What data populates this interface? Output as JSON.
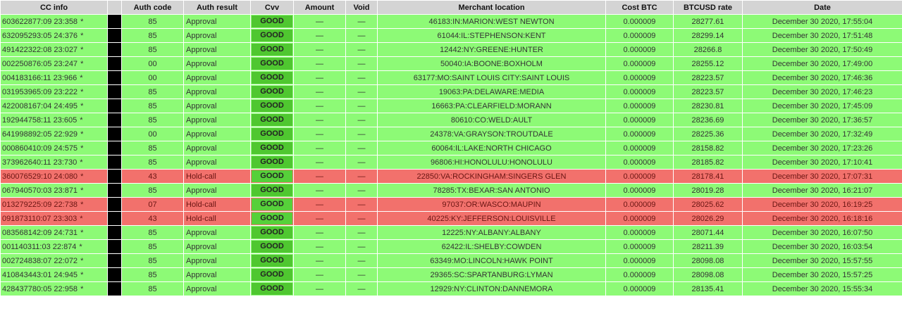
{
  "headers": [
    "CC info",
    "",
    "Auth code",
    "Auth result",
    "Cvv",
    "Amount",
    "Void",
    "Merchant location",
    "Cost BTC",
    "BTCUSD rate",
    "Date"
  ],
  "rows": [
    {
      "cc": "603622877:09 23:358",
      "star": "*",
      "code": "85",
      "result": "Approval",
      "cvv": "GOOD",
      "amount": "—",
      "void": "—",
      "loc": "46183:IN:MARION:WEST NEWTON",
      "cost": "0.000009",
      "rate": "28277.61",
      "date": "December 30 2020, 17:55:04",
      "status": "approve"
    },
    {
      "cc": "632095293:05 24:376",
      "star": "*",
      "code": "85",
      "result": "Approval",
      "cvv": "GOOD",
      "amount": "—",
      "void": "—",
      "loc": "61044:IL:STEPHENSON:KENT",
      "cost": "0.000009",
      "rate": "28299.14",
      "date": "December 30 2020, 17:51:48",
      "status": "approve"
    },
    {
      "cc": "491422322:08 23:027",
      "star": "*",
      "code": "85",
      "result": "Approval",
      "cvv": "GOOD",
      "amount": "—",
      "void": "—",
      "loc": "12442:NY:GREENE:HUNTER",
      "cost": "0.000009",
      "rate": "28266.8",
      "date": "December 30 2020, 17:50:49",
      "status": "approve"
    },
    {
      "cc": "002250876:05 23:247",
      "star": "*",
      "code": "00",
      "result": "Approval",
      "cvv": "GOOD",
      "amount": "—",
      "void": "—",
      "loc": "50040:IA:BOONE:BOXHOLM",
      "cost": "0.000009",
      "rate": "28255.12",
      "date": "December 30 2020, 17:49:00",
      "status": "approve"
    },
    {
      "cc": "004183166:11 23:966",
      "star": "*",
      "code": "00",
      "result": "Approval",
      "cvv": "GOOD",
      "amount": "—",
      "void": "—",
      "loc": "63177:MO:SAINT LOUIS CITY:SAINT LOUIS",
      "cost": "0.000009",
      "rate": "28223.57",
      "date": "December 30 2020, 17:46:36",
      "status": "approve"
    },
    {
      "cc": "031953965:09 23:222",
      "star": "*",
      "code": "85",
      "result": "Approval",
      "cvv": "GOOD",
      "amount": "—",
      "void": "—",
      "loc": "19063:PA:DELAWARE:MEDIA",
      "cost": "0.000009",
      "rate": "28223.57",
      "date": "December 30 2020, 17:46:23",
      "status": "approve"
    },
    {
      "cc": "422008167:04 24:495",
      "star": "*",
      "code": "85",
      "result": "Approval",
      "cvv": "GOOD",
      "amount": "—",
      "void": "—",
      "loc": "16663:PA:CLEARFIELD:MORANN",
      "cost": "0.000009",
      "rate": "28230.81",
      "date": "December 30 2020, 17:45:09",
      "status": "approve"
    },
    {
      "cc": "192944758:11 23:605",
      "star": "*",
      "code": "85",
      "result": "Approval",
      "cvv": "GOOD",
      "amount": "—",
      "void": "—",
      "loc": "80610:CO:WELD:AULT",
      "cost": "0.000009",
      "rate": "28236.69",
      "date": "December 30 2020, 17:36:57",
      "status": "approve"
    },
    {
      "cc": "641998892:05 22:929",
      "star": "*",
      "code": "00",
      "result": "Approval",
      "cvv": "GOOD",
      "amount": "—",
      "void": "—",
      "loc": "24378:VA:GRAYSON:TROUTDALE",
      "cost": "0.000009",
      "rate": "28225.36",
      "date": "December 30 2020, 17:32:49",
      "status": "approve"
    },
    {
      "cc": "000860410:09 24:575",
      "star": "*",
      "code": "85",
      "result": "Approval",
      "cvv": "GOOD",
      "amount": "—",
      "void": "—",
      "loc": "60064:IL:LAKE:NORTH CHICAGO",
      "cost": "0.000009",
      "rate": "28158.82",
      "date": "December 30 2020, 17:23:26",
      "status": "approve"
    },
    {
      "cc": "373962640:11 23:730",
      "star": "*",
      "code": "85",
      "result": "Approval",
      "cvv": "GOOD",
      "amount": "—",
      "void": "—",
      "loc": "96806:HI:HONOLULU:HONOLULU",
      "cost": "0.000009",
      "rate": "28185.82",
      "date": "December 30 2020, 17:10:41",
      "status": "approve"
    },
    {
      "cc": "360076529:10 24:080",
      "star": "*",
      "code": "43",
      "result": "Hold-call",
      "cvv": "GOOD",
      "amount": "—",
      "void": "—",
      "loc": "22850:VA:ROCKINGHAM:SINGERS GLEN",
      "cost": "0.000009",
      "rate": "28178.41",
      "date": "December 30 2020, 17:07:31",
      "status": "hold"
    },
    {
      "cc": "067940570:03 23:871",
      "star": "*",
      "code": "85",
      "result": "Approval",
      "cvv": "GOOD",
      "amount": "—",
      "void": "—",
      "loc": "78285:TX:BEXAR:SAN ANTONIO",
      "cost": "0.000009",
      "rate": "28019.28",
      "date": "December 30 2020, 16:21:07",
      "status": "approve"
    },
    {
      "cc": "013279225:09 22:738",
      "star": "*",
      "code": "07",
      "result": "Hold-call",
      "cvv": "GOOD",
      "amount": "—",
      "void": "—",
      "loc": "97037:OR:WASCO:MAUPIN",
      "cost": "0.000009",
      "rate": "28025.62",
      "date": "December 30 2020, 16:19:25",
      "status": "hold"
    },
    {
      "cc": "091873110:07 23:303",
      "star": "*",
      "code": "43",
      "result": "Hold-call",
      "cvv": "GOOD",
      "amount": "—",
      "void": "—",
      "loc": "40225:KY:JEFFERSON:LOUISVILLE",
      "cost": "0.000009",
      "rate": "28026.29",
      "date": "December 30 2020, 16:18:16",
      "status": "hold"
    },
    {
      "cc": "083568142:09 24:731",
      "star": "*",
      "code": "85",
      "result": "Approval",
      "cvv": "GOOD",
      "amount": "—",
      "void": "—",
      "loc": "12225:NY:ALBANY:ALBANY",
      "cost": "0.000009",
      "rate": "28071.44",
      "date": "December 30 2020, 16:07:50",
      "status": "approve"
    },
    {
      "cc": "001140311:03 22:874",
      "star": "*",
      "code": "85",
      "result": "Approval",
      "cvv": "GOOD",
      "amount": "—",
      "void": "—",
      "loc": "62422:IL:SHELBY:COWDEN",
      "cost": "0.000009",
      "rate": "28211.39",
      "date": "December 30 2020, 16:03:54",
      "status": "approve"
    },
    {
      "cc": "002724838:07 22:072",
      "star": "*",
      "code": "85",
      "result": "Approval",
      "cvv": "GOOD",
      "amount": "—",
      "void": "—",
      "loc": "63349:MO:LINCOLN:HAWK POINT",
      "cost": "0.000009",
      "rate": "28098.08",
      "date": "December 30 2020, 15:57:55",
      "status": "approve"
    },
    {
      "cc": "410843443:01 24:945",
      "star": "*",
      "code": "85",
      "result": "Approval",
      "cvv": "GOOD",
      "amount": "—",
      "void": "—",
      "loc": "29365:SC:SPARTANBURG:LYMAN",
      "cost": "0.000009",
      "rate": "28098.08",
      "date": "December 30 2020, 15:57:25",
      "status": "approve"
    },
    {
      "cc": "428437780:05 22:958",
      "star": "*",
      "code": "85",
      "result": "Approval",
      "cvv": "GOOD",
      "amount": "—",
      "void": "—",
      "loc": "12929:NY:CLINTON:DANNEMORA",
      "cost": "0.000009",
      "rate": "28135.41",
      "date": "December 30 2020, 15:55:34",
      "status": "approve"
    }
  ],
  "colors": {
    "approve": "#8dfa76",
    "hold": "#f2716c",
    "cvv_badge": "#4fc730",
    "header": "#d4d4d4"
  }
}
